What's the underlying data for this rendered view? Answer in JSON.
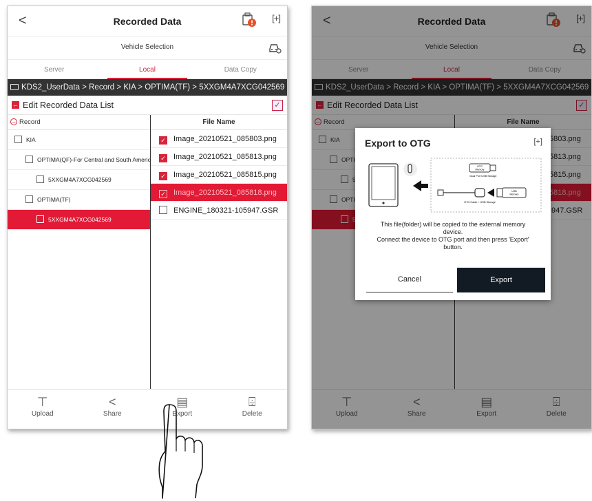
{
  "app": {
    "back_glyph": "<",
    "title": "Recorded Data",
    "fullscreen_glyph": "[+]",
    "vehicle_selection": "Vehicle Selection",
    "tabs": [
      {
        "label": "Server",
        "active": false
      },
      {
        "label": "Local",
        "active": true
      },
      {
        "label": "Data Copy",
        "active": false
      }
    ],
    "breadcrumb": "KDS2_UserData > Record > KIA > OPTIMA(TF) > 5XXGM4A7XCG042569",
    "edit_label": "Edit Recorded Data List",
    "edit_icon_glyph": "←",
    "check_glyph": "✓",
    "tree_header": "Record",
    "tree": [
      {
        "label": "KIA",
        "selected": false
      },
      {
        "label": "OPTIMA(QF)-For Central and South America",
        "selected": false
      },
      {
        "label": "5XXGM4A7XCG042569",
        "selected": false
      },
      {
        "label": "OPTIMA(TF)",
        "selected": false
      },
      {
        "label": "5XXGM4A7XCG042569",
        "selected": true
      }
    ],
    "files_header": "File Name",
    "files": [
      {
        "name": "Image_20210521_085803.png",
        "checked": true,
        "selected": false
      },
      {
        "name": "Image_20210521_085813.png",
        "checked": true,
        "selected": false
      },
      {
        "name": "Image_20210521_085815.png",
        "checked": true,
        "selected": false
      },
      {
        "name": "Image_20210521_085818.png",
        "checked": true,
        "selected": true
      },
      {
        "name": "ENGINE_180321-105947.GSR",
        "checked": false,
        "selected": false
      }
    ],
    "bottom_bar": [
      {
        "label": "Upload",
        "icon": "upload-icon",
        "glyph": "⊤"
      },
      {
        "label": "Share",
        "icon": "share-icon",
        "glyph": "<"
      },
      {
        "label": "Export",
        "icon": "export-icon",
        "glyph": "▤"
      },
      {
        "label": "Delete",
        "icon": "delete-icon",
        "glyph": "⌹"
      }
    ],
    "accent_color": "#d8243b",
    "selected_row_color": "#e21a36",
    "dark_color": "#121b23"
  },
  "dialog": {
    "title": "Export to OTG",
    "fullscreen_glyph": "[+]",
    "illustration": {
      "otg_memory": [
        "OTG",
        "Memory"
      ],
      "dual_port": "Dual Port USB Storage",
      "otg_cable": "OTG Cable + USB Storage",
      "usb_memory": [
        "USB",
        "Memory"
      ]
    },
    "message": [
      "This file(folder) will be copied to the external memory",
      "device.",
      "Connect the device to OTG port and then press 'Export'",
      "button."
    ],
    "cancel_label": "Cancel",
    "export_label": "Export"
  }
}
